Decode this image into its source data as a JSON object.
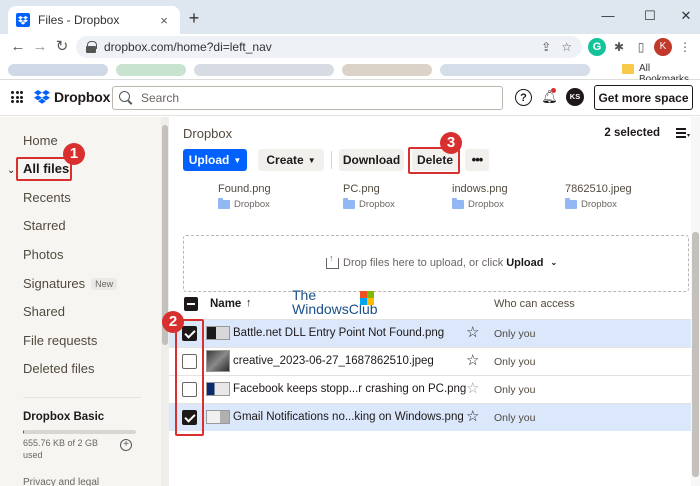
{
  "browser": {
    "tab_title": "Files - Dropbox",
    "tab_close": "×",
    "new_tab": "+",
    "url": "dropbox.com/home?di=left_nav",
    "profile_initial": "K",
    "ext_g": "G",
    "bookmarks_label": "All Bookmarks",
    "window_controls": [
      "—",
      "☐",
      "✕"
    ]
  },
  "header": {
    "brand": "Dropbox",
    "search_placeholder": "Search",
    "help": "?",
    "avatar": "KS",
    "get_space": "Get more space"
  },
  "sidebar": {
    "items": [
      {
        "label": "Home"
      },
      {
        "label": "All files"
      },
      {
        "label": "Recents"
      },
      {
        "label": "Starred"
      },
      {
        "label": "Photos"
      },
      {
        "label": "Signatures",
        "badge": "New"
      },
      {
        "label": "Shared"
      },
      {
        "label": "File requests"
      },
      {
        "label": "Deleted files"
      }
    ],
    "plan": {
      "title": "Dropbox Basic",
      "usage": "655.76 KB of 2 GB used",
      "usage_fraction": 0.0003
    },
    "privacy": "Privacy and legal"
  },
  "main": {
    "breadcrumb": "Dropbox",
    "selected_count": "2 selected",
    "buttons": {
      "upload": "Upload",
      "create": "Create",
      "download": "Download",
      "delete": "Delete",
      "more": "•••"
    },
    "thumbs": [
      {
        "name": "Found.png",
        "location": "Dropbox"
      },
      {
        "name": "PC.png",
        "location": "Dropbox"
      },
      {
        "name": "indows.png",
        "location": "Dropbox"
      },
      {
        "name": "7862510.jpeg",
        "location": "Dropbox"
      }
    ],
    "dropzone": {
      "text": "Drop files here to upload, or click",
      "link": "Upload"
    },
    "table": {
      "col_name": "Name",
      "sort_arrow": "↑",
      "col_access": "Who can access",
      "rows": [
        {
          "name": "Battle.net DLL Entry Point Not Found.png",
          "access": "Only you",
          "checked": true,
          "starred": true
        },
        {
          "name": "creative_2023-06-27_1687862510.jpeg",
          "access": "Only you",
          "checked": false,
          "starred": true
        },
        {
          "name": "Facebook keeps stopp...r crashing on PC.png",
          "access": "Only you",
          "checked": false,
          "starred": false
        },
        {
          "name": "Gmail Notifications no...king on Windows.png",
          "access": "Only you",
          "checked": true,
          "starred": true
        }
      ]
    },
    "watermark": {
      "line1": "The",
      "line2": "WindowsClub"
    }
  },
  "annotations": [
    "1",
    "2",
    "3"
  ],
  "colors": {
    "accent": "#0061fe",
    "highlight": "#d8302f",
    "selected_row": "#dbe7fb"
  }
}
